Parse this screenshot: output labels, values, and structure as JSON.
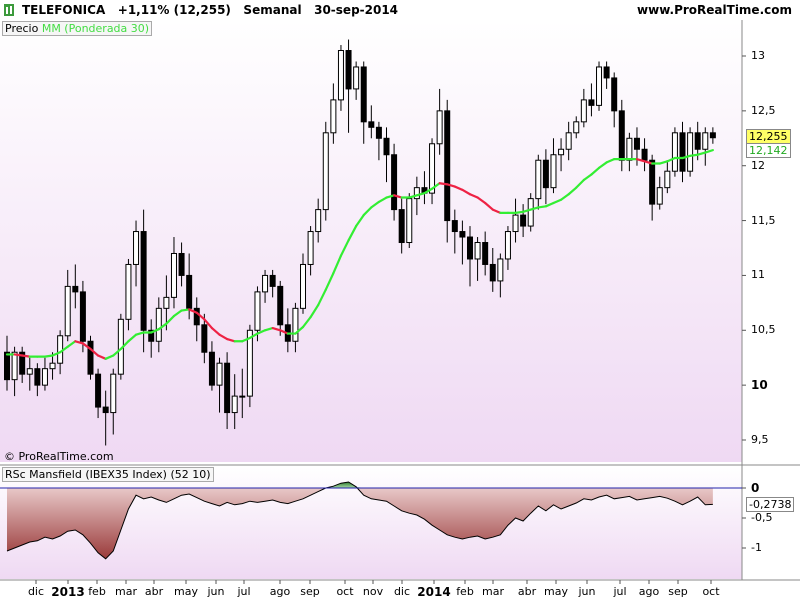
{
  "header": {
    "title": "TELEFONICA   +1,11% (12,255)   Semanal   30-sep-2014",
    "url": "www.ProRealTime.com"
  },
  "legend": {
    "price_label": "Precio",
    "ma_label": "MM (Ponderada 30)",
    "indicator_label": "RSc Mansfield (IBEX35 Index) (52 10)"
  },
  "copyright": "© ProRealTime.com",
  "badges": {
    "last_price": "12,255",
    "ma_value": "12,142",
    "rsc_value": "-0,2738"
  },
  "price_axis_ticks": [
    "13",
    "12,5",
    "12",
    "11,5",
    "11",
    "10,5",
    "10",
    "9,5"
  ],
  "rsc_axis_ticks": [
    "0",
    "-0,5",
    "-1"
  ],
  "x_axis_ticks": [
    "dic",
    "2013",
    "feb",
    "mar",
    "abr",
    "may",
    "jun",
    "jul",
    "ago",
    "sep",
    "oct",
    "nov",
    "dic",
    "2014",
    "feb",
    "mar",
    "abr",
    "may",
    "jun",
    "jul",
    "ago",
    "sep",
    "oct"
  ],
  "colors": {
    "background_top": "#ffffff",
    "background_bottom": "#efd9f3",
    "candle_up": "#ffffff",
    "candle_down": "#000000",
    "ma_up": "#33ee33",
    "ma_down": "#ee2244",
    "rsc_negative": "#a04040",
    "rsc_positive": "#3a8a3a",
    "zero_line": "#2222aa"
  },
  "chart_data": [
    {
      "type": "candlestick",
      "title": "TELEFONICA",
      "interval": "weekly",
      "ylim": [
        9.3,
        13.3
      ],
      "candles": [
        {
          "o": 10.3,
          "h": 10.45,
          "l": 9.95,
          "c": 10.05
        },
        {
          "o": 10.05,
          "h": 10.35,
          "l": 9.9,
          "c": 10.3
        },
        {
          "o": 10.3,
          "h": 10.35,
          "l": 10.02,
          "c": 10.1
        },
        {
          "o": 10.1,
          "h": 10.25,
          "l": 9.95,
          "c": 10.15
        },
        {
          "o": 10.15,
          "h": 10.2,
          "l": 9.9,
          "c": 10.0
        },
        {
          "o": 10.0,
          "h": 10.25,
          "l": 9.95,
          "c": 10.15
        },
        {
          "o": 10.15,
          "h": 10.3,
          "l": 10.05,
          "c": 10.2
        },
        {
          "o": 10.2,
          "h": 10.5,
          "l": 10.1,
          "c": 10.45
        },
        {
          "o": 10.45,
          "h": 11.05,
          "l": 10.4,
          "c": 10.9
        },
        {
          "o": 10.9,
          "h": 11.1,
          "l": 10.7,
          "c": 10.85
        },
        {
          "o": 10.85,
          "h": 10.95,
          "l": 10.3,
          "c": 10.4
        },
        {
          "o": 10.4,
          "h": 10.45,
          "l": 10.05,
          "c": 10.1
        },
        {
          "o": 10.1,
          "h": 10.15,
          "l": 9.7,
          "c": 9.8
        },
        {
          "o": 9.8,
          "h": 9.95,
          "l": 9.45,
          "c": 9.75
        },
        {
          "o": 9.75,
          "h": 10.15,
          "l": 9.55,
          "c": 10.1
        },
        {
          "o": 10.1,
          "h": 10.65,
          "l": 10.05,
          "c": 10.6
        },
        {
          "o": 10.6,
          "h": 11.15,
          "l": 10.5,
          "c": 11.1
        },
        {
          "o": 11.1,
          "h": 11.5,
          "l": 10.9,
          "c": 11.4
        },
        {
          "o": 11.4,
          "h": 11.6,
          "l": 10.3,
          "c": 10.5
        },
        {
          "o": 10.5,
          "h": 10.6,
          "l": 10.25,
          "c": 10.4
        },
        {
          "o": 10.4,
          "h": 10.8,
          "l": 10.3,
          "c": 10.7
        },
        {
          "o": 10.7,
          "h": 11.0,
          "l": 10.5,
          "c": 10.8
        },
        {
          "o": 10.8,
          "h": 11.35,
          "l": 10.7,
          "c": 11.2
        },
        {
          "o": 11.2,
          "h": 11.3,
          "l": 10.9,
          "c": 11.0
        },
        {
          "o": 11.0,
          "h": 11.2,
          "l": 10.6,
          "c": 10.7
        },
        {
          "o": 10.7,
          "h": 10.8,
          "l": 10.4,
          "c": 10.55
        },
        {
          "o": 10.55,
          "h": 10.65,
          "l": 10.2,
          "c": 10.3
        },
        {
          "o": 10.3,
          "h": 10.4,
          "l": 9.95,
          "c": 10.0
        },
        {
          "o": 10.0,
          "h": 10.25,
          "l": 9.75,
          "c": 10.2
        },
        {
          "o": 10.2,
          "h": 10.3,
          "l": 9.6,
          "c": 9.75
        },
        {
          "o": 9.75,
          "h": 10.1,
          "l": 9.6,
          "c": 9.9
        },
        {
          "o": 9.9,
          "h": 10.15,
          "l": 9.7,
          "c": 9.9
        },
        {
          "o": 9.9,
          "h": 10.55,
          "l": 9.8,
          "c": 10.5
        },
        {
          "o": 10.5,
          "h": 10.9,
          "l": 10.4,
          "c": 10.85
        },
        {
          "o": 10.85,
          "h": 11.05,
          "l": 10.75,
          "c": 11.0
        },
        {
          "o": 11.0,
          "h": 11.05,
          "l": 10.8,
          "c": 10.9
        },
        {
          "o": 10.9,
          "h": 10.95,
          "l": 10.45,
          "c": 10.55
        },
        {
          "o": 10.55,
          "h": 10.7,
          "l": 10.3,
          "c": 10.4
        },
        {
          "o": 10.4,
          "h": 10.75,
          "l": 10.3,
          "c": 10.7
        },
        {
          "o": 10.7,
          "h": 11.2,
          "l": 10.65,
          "c": 11.1
        },
        {
          "o": 11.1,
          "h": 11.45,
          "l": 11.0,
          "c": 11.4
        },
        {
          "o": 11.4,
          "h": 11.7,
          "l": 11.3,
          "c": 11.6
        },
        {
          "o": 11.6,
          "h": 12.4,
          "l": 11.5,
          "c": 12.3
        },
        {
          "o": 12.3,
          "h": 12.75,
          "l": 12.2,
          "c": 12.6
        },
        {
          "o": 12.6,
          "h": 13.1,
          "l": 12.5,
          "c": 13.05
        },
        {
          "o": 13.05,
          "h": 13.15,
          "l": 12.3,
          "c": 12.7
        },
        {
          "o": 12.7,
          "h": 12.95,
          "l": 12.6,
          "c": 12.9
        },
        {
          "o": 12.9,
          "h": 12.95,
          "l": 12.2,
          "c": 12.4
        },
        {
          "o": 12.4,
          "h": 12.55,
          "l": 12.25,
          "c": 12.35
        },
        {
          "o": 12.35,
          "h": 12.4,
          "l": 12.05,
          "c": 12.25
        },
        {
          "o": 12.25,
          "h": 12.35,
          "l": 11.85,
          "c": 12.1
        },
        {
          "o": 12.1,
          "h": 12.2,
          "l": 11.5,
          "c": 11.6
        },
        {
          "o": 11.6,
          "h": 11.7,
          "l": 11.2,
          "c": 11.3
        },
        {
          "o": 11.3,
          "h": 11.75,
          "l": 11.25,
          "c": 11.7
        },
        {
          "o": 11.7,
          "h": 11.9,
          "l": 11.55,
          "c": 11.8
        },
        {
          "o": 11.8,
          "h": 11.95,
          "l": 11.65,
          "c": 11.75
        },
        {
          "o": 11.75,
          "h": 12.25,
          "l": 11.65,
          "c": 12.2
        },
        {
          "o": 12.2,
          "h": 12.7,
          "l": 12.1,
          "c": 12.5
        },
        {
          "o": 12.5,
          "h": 12.6,
          "l": 11.3,
          "c": 11.5
        },
        {
          "o": 11.5,
          "h": 11.6,
          "l": 11.2,
          "c": 11.4
        },
        {
          "o": 11.4,
          "h": 11.5,
          "l": 11.1,
          "c": 11.35
        },
        {
          "o": 11.35,
          "h": 11.45,
          "l": 10.9,
          "c": 11.15
        },
        {
          "o": 11.15,
          "h": 11.35,
          "l": 10.95,
          "c": 11.3
        },
        {
          "o": 11.3,
          "h": 11.4,
          "l": 11.0,
          "c": 11.1
        },
        {
          "o": 11.1,
          "h": 11.25,
          "l": 10.85,
          "c": 10.95
        },
        {
          "o": 10.95,
          "h": 11.2,
          "l": 10.8,
          "c": 11.15
        },
        {
          "o": 11.15,
          "h": 11.45,
          "l": 11.05,
          "c": 11.4
        },
        {
          "o": 11.4,
          "h": 11.7,
          "l": 11.3,
          "c": 11.55
        },
        {
          "o": 11.55,
          "h": 11.65,
          "l": 11.35,
          "c": 11.45
        },
        {
          "o": 11.45,
          "h": 11.75,
          "l": 11.4,
          "c": 11.7
        },
        {
          "o": 11.7,
          "h": 12.1,
          "l": 11.6,
          "c": 12.05
        },
        {
          "o": 12.05,
          "h": 12.15,
          "l": 11.65,
          "c": 11.8
        },
        {
          "o": 11.8,
          "h": 12.25,
          "l": 11.75,
          "c": 12.1
        },
        {
          "o": 12.1,
          "h": 12.25,
          "l": 11.95,
          "c": 12.15
        },
        {
          "o": 12.15,
          "h": 12.4,
          "l": 12.05,
          "c": 12.3
        },
        {
          "o": 12.3,
          "h": 12.45,
          "l": 12.25,
          "c": 12.4
        },
        {
          "o": 12.4,
          "h": 12.7,
          "l": 12.35,
          "c": 12.6
        },
        {
          "o": 12.6,
          "h": 12.75,
          "l": 12.45,
          "c": 12.55
        },
        {
          "o": 12.55,
          "h": 12.95,
          "l": 12.5,
          "c": 12.9
        },
        {
          "o": 12.9,
          "h": 12.95,
          "l": 12.7,
          "c": 12.8
        },
        {
          "o": 12.8,
          "h": 12.85,
          "l": 12.35,
          "c": 12.5
        },
        {
          "o": 12.5,
          "h": 12.6,
          "l": 11.95,
          "c": 12.05
        },
        {
          "o": 12.05,
          "h": 12.3,
          "l": 11.95,
          "c": 12.25
        },
        {
          "o": 12.25,
          "h": 12.35,
          "l": 12.0,
          "c": 12.15
        },
        {
          "o": 12.15,
          "h": 12.25,
          "l": 11.95,
          "c": 12.05
        },
        {
          "o": 12.05,
          "h": 12.1,
          "l": 11.5,
          "c": 11.65
        },
        {
          "o": 11.65,
          "h": 11.9,
          "l": 11.6,
          "c": 11.8
        },
        {
          "o": 11.8,
          "h": 12.05,
          "l": 11.75,
          "c": 11.95
        },
        {
          "o": 11.95,
          "h": 12.35,
          "l": 11.9,
          "c": 12.3
        },
        {
          "o": 12.3,
          "h": 12.4,
          "l": 11.85,
          "c": 11.95
        },
        {
          "o": 11.95,
          "h": 12.35,
          "l": 11.9,
          "c": 12.3
        },
        {
          "o": 12.3,
          "h": 12.4,
          "l": 12.05,
          "c": 12.15
        },
        {
          "o": 12.15,
          "h": 12.35,
          "l": 12.0,
          "c": 12.3
        },
        {
          "o": 12.3,
          "h": 12.35,
          "l": 12.2,
          "c": 12.255
        }
      ],
      "series": [
        {
          "name": "MM (Ponderada 30)",
          "values": [
            10.28,
            10.28,
            10.27,
            10.26,
            10.26,
            10.26,
            10.27,
            10.3,
            10.35,
            10.4,
            10.38,
            10.33,
            10.27,
            10.24,
            10.27,
            10.33,
            10.4,
            10.46,
            10.48,
            10.48,
            10.51,
            10.56,
            10.63,
            10.68,
            10.69,
            10.66,
            10.6,
            10.52,
            10.46,
            10.42,
            10.4,
            10.4,
            10.43,
            10.47,
            10.5,
            10.52,
            10.5,
            10.47,
            10.47,
            10.53,
            10.62,
            10.73,
            10.87,
            11.02,
            11.18,
            11.32,
            11.45,
            11.55,
            11.62,
            11.67,
            11.71,
            11.73,
            11.71,
            11.71,
            11.73,
            11.75,
            11.79,
            11.84,
            11.83,
            11.81,
            11.78,
            11.74,
            11.71,
            11.66,
            11.6,
            11.57,
            11.57,
            11.57,
            11.58,
            11.6,
            11.62,
            11.63,
            11.66,
            11.69,
            11.74,
            11.8,
            11.87,
            11.92,
            11.98,
            12.03,
            12.06,
            12.06,
            12.06,
            12.06,
            12.04,
            12.02,
            12.02,
            12.04,
            12.07,
            12.07,
            12.09,
            12.1,
            12.12,
            12.142
          ]
        }
      ]
    },
    {
      "type": "area",
      "title": "RSc Mansfield (IBEX35 Index) (52 10)",
      "ylim": [
        -1.3,
        0.2
      ],
      "series": [
        {
          "name": "RSc Mansfield",
          "values": [
            -1.05,
            -1.0,
            -0.95,
            -0.9,
            -0.88,
            -0.82,
            -0.85,
            -0.8,
            -0.72,
            -0.7,
            -0.78,
            -0.92,
            -1.08,
            -1.18,
            -1.05,
            -0.7,
            -0.35,
            -0.12,
            -0.18,
            -0.15,
            -0.2,
            -0.24,
            -0.18,
            -0.12,
            -0.1,
            -0.16,
            -0.22,
            -0.26,
            -0.3,
            -0.24,
            -0.28,
            -0.26,
            -0.22,
            -0.24,
            -0.22,
            -0.2,
            -0.24,
            -0.26,
            -0.22,
            -0.18,
            -0.12,
            -0.06,
            0.0,
            0.03,
            0.08,
            0.1,
            0.02,
            -0.12,
            -0.18,
            -0.2,
            -0.22,
            -0.3,
            -0.38,
            -0.42,
            -0.45,
            -0.52,
            -0.62,
            -0.7,
            -0.78,
            -0.82,
            -0.85,
            -0.82,
            -0.8,
            -0.85,
            -0.82,
            -0.78,
            -0.62,
            -0.5,
            -0.55,
            -0.42,
            -0.3,
            -0.38,
            -0.28,
            -0.35,
            -0.3,
            -0.25,
            -0.18,
            -0.2,
            -0.15,
            -0.12,
            -0.18,
            -0.16,
            -0.14,
            -0.2,
            -0.18,
            -0.16,
            -0.14,
            -0.17,
            -0.22,
            -0.28,
            -0.22,
            -0.15,
            -0.28,
            -0.2738
          ]
        }
      ]
    }
  ]
}
